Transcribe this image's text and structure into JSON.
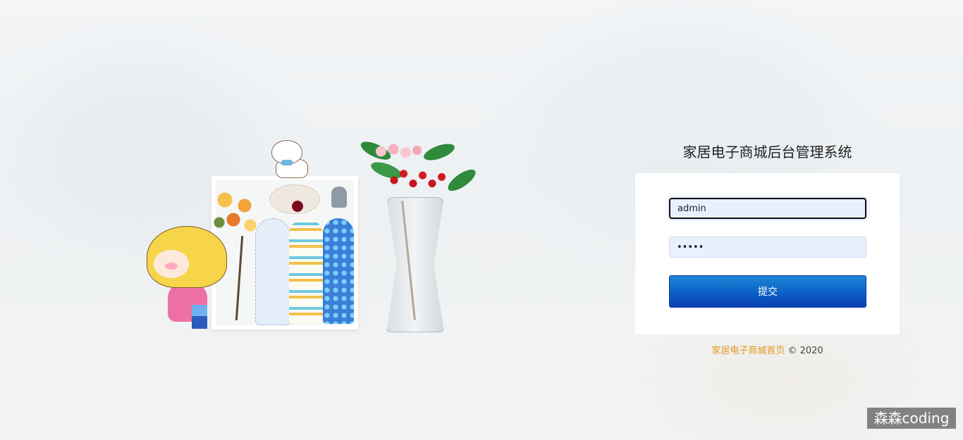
{
  "login": {
    "title": "家居电子商城后台管理系统",
    "username_value": "admin",
    "password_value": "admin",
    "submit_label": "提交"
  },
  "footer": {
    "home_link": "家居电子商城首页",
    "copyright": " © 2020"
  },
  "watermark": {
    "text": "森森coding"
  },
  "colors": {
    "button_top": "#1b86d6",
    "button_bottom": "#0840b5",
    "input_bg": "#e8f0fe",
    "link": "#e39a20"
  }
}
